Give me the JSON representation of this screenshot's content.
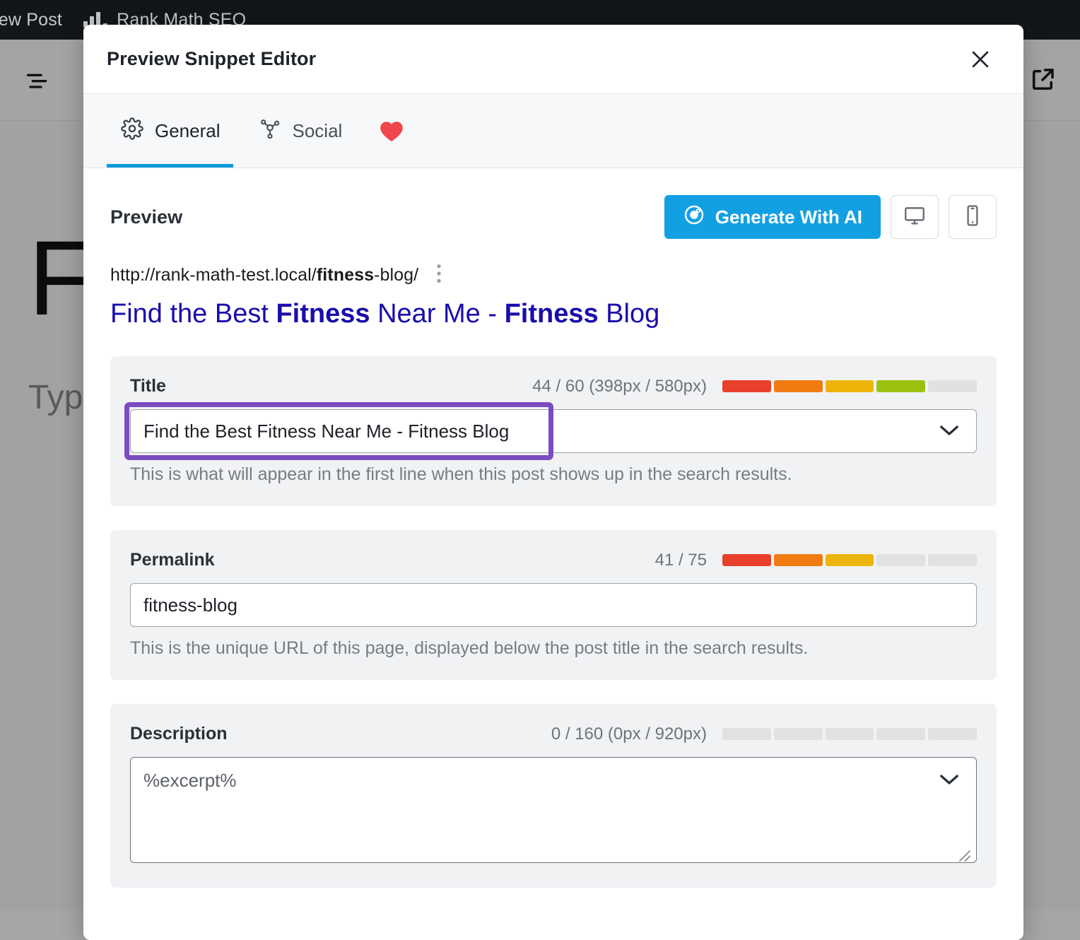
{
  "background": {
    "admin_bar": {
      "items": [
        {
          "label": "iew Post",
          "icon": "none"
        },
        {
          "label": "Rank Math SEO",
          "icon": "rank-math-logo-icon"
        }
      ]
    },
    "toolbar": {
      "left_icon": "list-view-icon",
      "right_icon": "external-link-icon"
    },
    "post": {
      "title": "F",
      "body": "Type"
    }
  },
  "modal": {
    "title": "Preview Snippet Editor",
    "close_icon": "close-icon",
    "tabs": [
      {
        "label": "General",
        "icon": "gear-icon",
        "active": true
      },
      {
        "label": "Social",
        "icon": "share-nodes-icon",
        "active": false
      }
    ],
    "heart_icon": "heart-icon",
    "heart_color": "#f0454a",
    "accent_color": "#0c9ad8"
  },
  "preview": {
    "label": "Preview",
    "generate_ai": {
      "label": "Generate With AI",
      "icon": "ai-circle-icon",
      "color": "#13a0e3"
    },
    "device_buttons": [
      {
        "icon": "desktop-icon",
        "name": "desktop-preview-button"
      },
      {
        "icon": "mobile-icon",
        "name": "mobile-preview-button"
      }
    ],
    "serp": {
      "url_prefix": "http://rank-math-test.local/",
      "url_bold": "fitness",
      "url_suffix": "-blog/",
      "menu_icon": "kebab-menu-icon",
      "title_parts": [
        {
          "text": "Find the Best ",
          "bold": false
        },
        {
          "text": "Fitness",
          "bold": true
        },
        {
          "text": " Near Me - ",
          "bold": false
        },
        {
          "text": "Fitness",
          "bold": true
        },
        {
          "text": " Blog",
          "bold": false
        }
      ],
      "title_color": "#1a0dab"
    }
  },
  "fields": {
    "title": {
      "label": "Title",
      "counter": "44 / 60 (398px / 580px)",
      "progress_filled": 4,
      "progress_total": 5,
      "progress_colors": [
        "#e8402a",
        "#f07c11",
        "#edb40a",
        "#9cc211",
        "#e0e1e3"
      ],
      "value": "Find the Best Fitness Near Me - Fitness Blog",
      "help": "This is what will appear in the first line when this post shows up in the search results.",
      "chevron_icon": "chevron-down-icon",
      "highlight_color": "#7b4cc0"
    },
    "permalink": {
      "label": "Permalink",
      "counter": "41 / 75",
      "progress_filled": 3,
      "progress_total": 5,
      "progress_colors": [
        "#e8402a",
        "#f07c11",
        "#edb40a",
        "#e0e1e3",
        "#e0e1e3"
      ],
      "value": "fitness-blog",
      "help": "This is the unique URL of this page, displayed below the post title in the search results."
    },
    "description": {
      "label": "Description",
      "counter": "0 / 160 (0px / 920px)",
      "progress_filled": 0,
      "progress_total": 5,
      "progress_colors": [
        "#e0e1e3",
        "#e0e1e3",
        "#e0e1e3",
        "#e0e1e3",
        "#e0e1e3"
      ],
      "value": "%excerpt%",
      "chevron_icon": "chevron-down-icon"
    }
  }
}
